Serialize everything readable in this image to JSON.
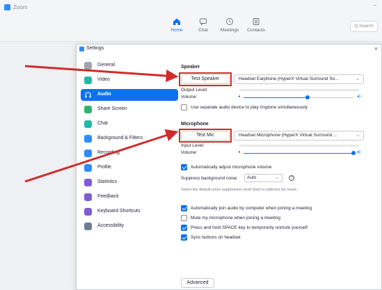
{
  "app": {
    "title": "Zoom",
    "minimize_glyph": "–",
    "nav": [
      {
        "label": "Home",
        "icon": "home-icon"
      },
      {
        "label": "Chat",
        "icon": "chat-icon"
      },
      {
        "label": "Meetings",
        "icon": "clock-icon"
      },
      {
        "label": "Contacts",
        "icon": "contacts-icon"
      }
    ],
    "search_label": "Q  Search"
  },
  "settings": {
    "title": "Settings",
    "close_glyph": "×",
    "sidebar": [
      {
        "label": "General"
      },
      {
        "label": "Video"
      },
      {
        "label": "Audio"
      },
      {
        "label": "Share Screen"
      },
      {
        "label": "Chat"
      },
      {
        "label": "Background & Filters"
      },
      {
        "label": "Recording"
      },
      {
        "label": "Profile"
      },
      {
        "label": "Statistics"
      },
      {
        "label": "Feedback"
      },
      {
        "label": "Keyboard Shortcuts"
      },
      {
        "label": "Accessibility"
      }
    ],
    "speaker": {
      "heading": "Speaker",
      "test_button": "Test Speaker",
      "device": "Headset Earphone (HyperX Virtual Surround So...",
      "output_level_label": "Output Level:",
      "volume_label": "Volume:",
      "volume_level": 0.58
    },
    "separate_device": {
      "label": "Use separate audio device to play ringtone simultaneously",
      "checked": false
    },
    "microphone": {
      "heading": "Microphone",
      "test_button": "Test Mic",
      "device": "Headset Microphone (HyperX Virtual Surround ...",
      "input_level_label": "Input Level:",
      "volume_label": "Volume:",
      "volume_level": 1.0
    },
    "auto_adjust": {
      "label": "Automatically adjust microphone volume",
      "checked": true
    },
    "noise": {
      "label": "Suppress background noise",
      "value": "Auto",
      "hint": "Select the default noise suppression level (low) to optimize for music.",
      "help_glyph": "?"
    },
    "options": [
      {
        "label": "Automatically join audio by computer when joining a meeting",
        "checked": true
      },
      {
        "label": "Mute my microphone when joining a meeting",
        "checked": false
      },
      {
        "label": "Press and hold SPACE key to temporarily unmute yourself",
        "checked": true
      },
      {
        "label": "Sync buttons on headset",
        "checked": true
      }
    ],
    "advanced_button": "Advanced"
  },
  "colors": {
    "accent": "#0e72ed",
    "highlight": "#d22a2a"
  }
}
